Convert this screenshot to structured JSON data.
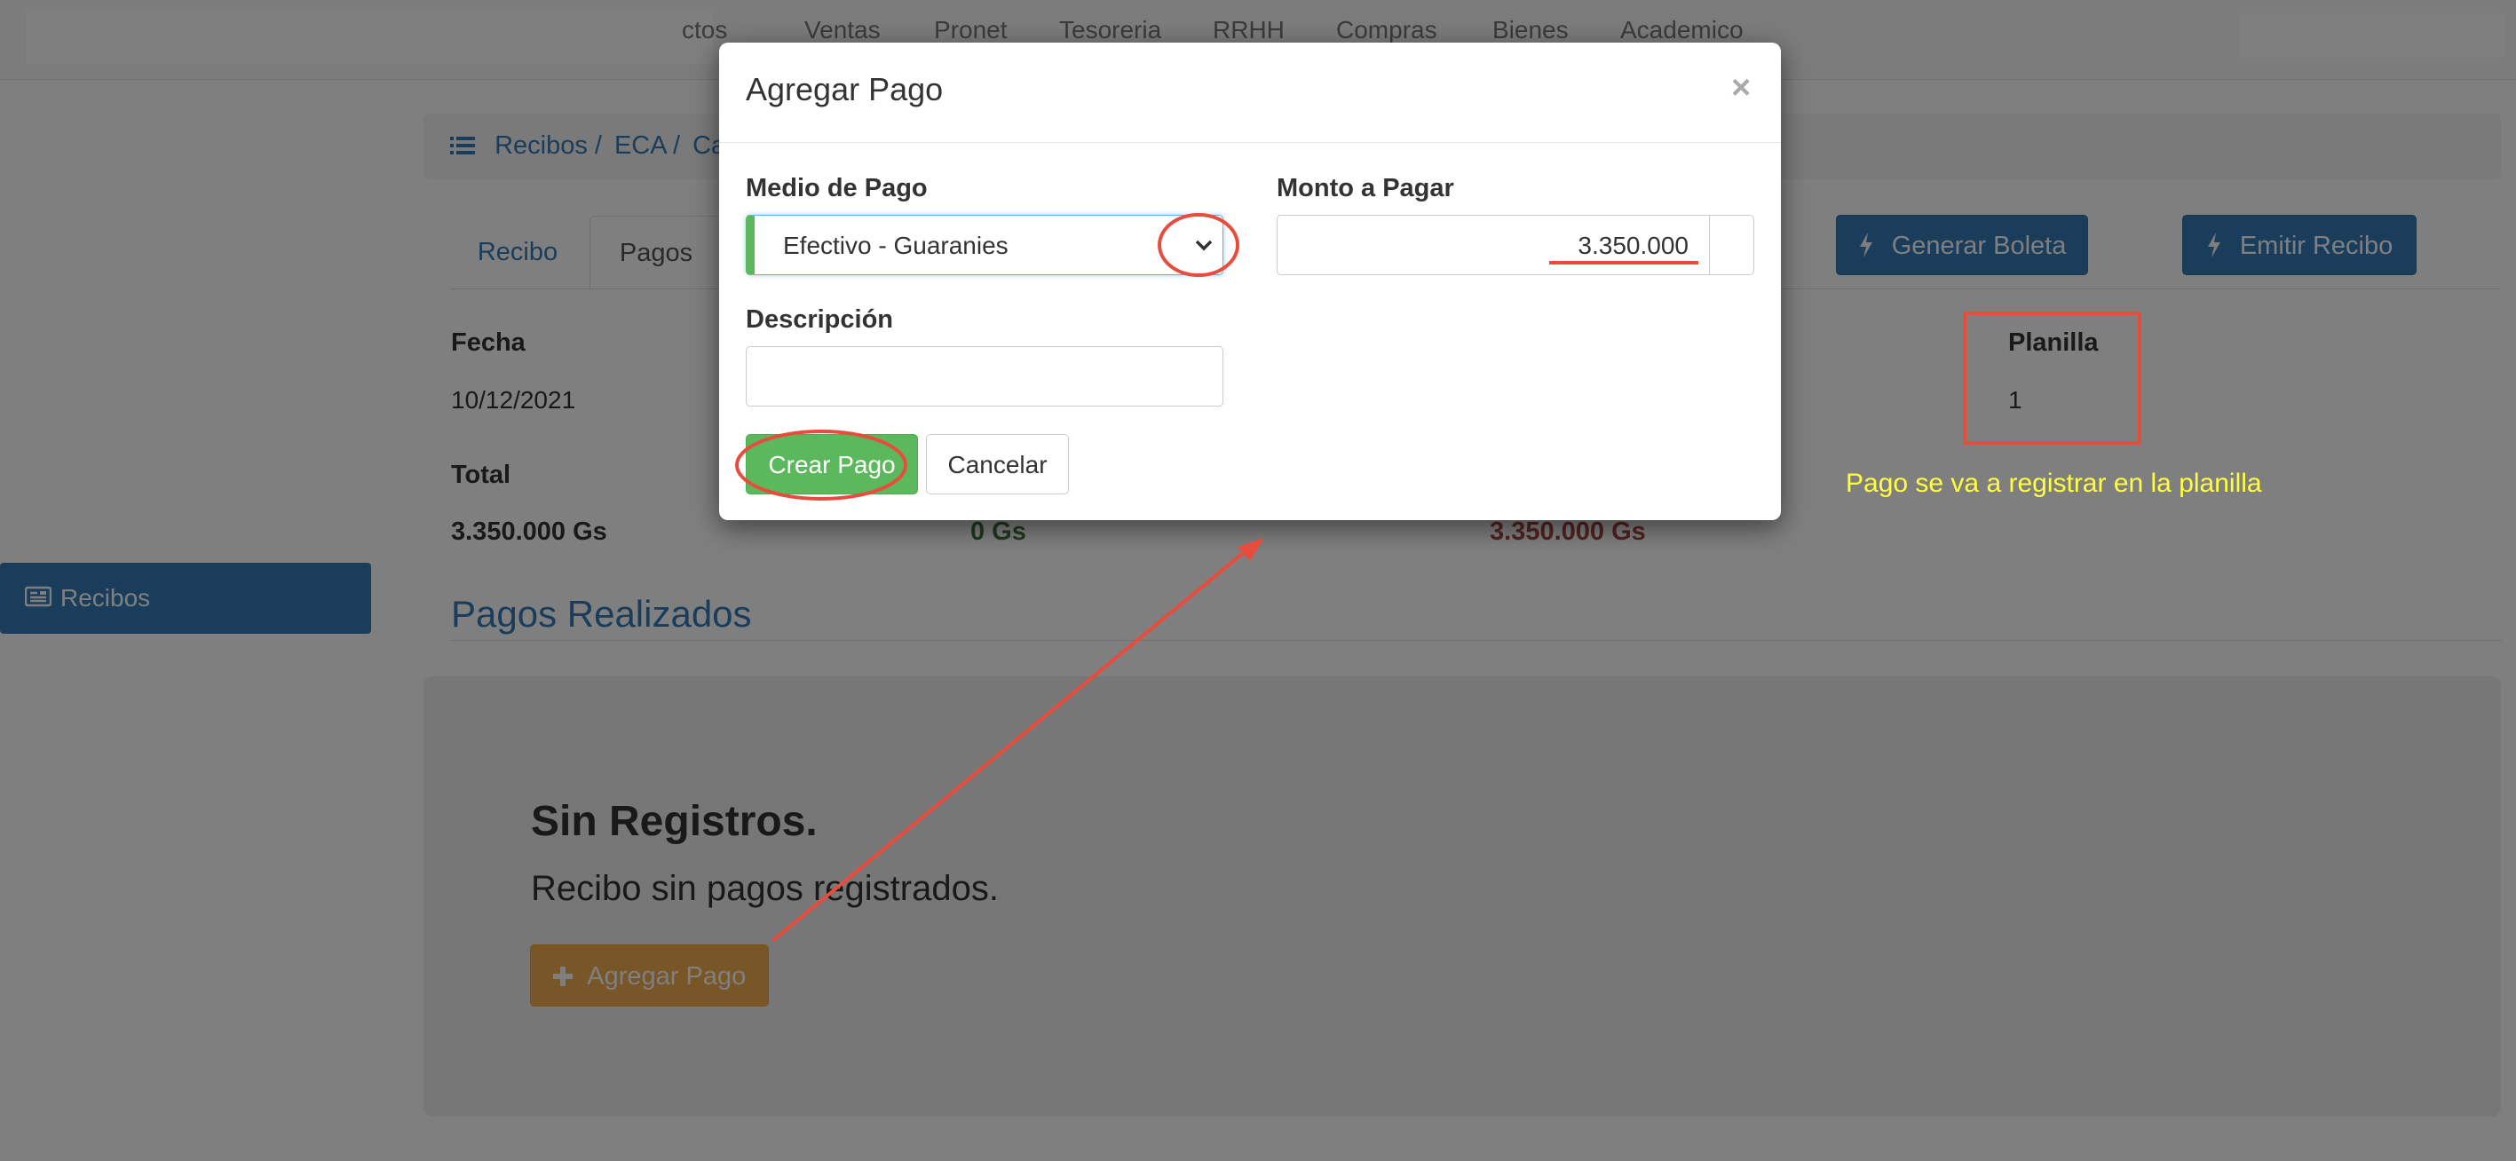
{
  "navbar": {
    "items": [
      "ctos",
      "Ventas",
      "Pronet",
      "Tesoreria",
      "RRHH",
      "Compras",
      "Bienes",
      "Academico"
    ]
  },
  "sidebar": {
    "active_item": {
      "label": "Recibos",
      "icon": "receipt-icon"
    }
  },
  "breadcrumb": {
    "items": [
      "Recibos /",
      "ECA /",
      "Caj"
    ],
    "icon": "list-icon"
  },
  "tabs": [
    {
      "label": "Recibo"
    },
    {
      "label": "Pagos",
      "active": true
    }
  ],
  "actions": {
    "generar_boleta": "Generar Boleta",
    "emitir_recibo": "Emitir Recibo",
    "icon": "bolt-icon"
  },
  "info": {
    "fecha_label": "Fecha",
    "fecha_value": "10/12/2021",
    "planilla_label": "Planilla",
    "planilla_value": "1",
    "total_label": "Total",
    "total_value": "3.350.000 Gs",
    "pagado_value": "0 Gs",
    "saldo_value": "3.350.000 Gs"
  },
  "pagos_realizados": {
    "title": "Pagos Realizados",
    "empty_title": "Sin Registros.",
    "empty_text": "Recibo sin pagos registrados.",
    "add_button": "Agregar Pago",
    "add_icon": "plus-icon"
  },
  "modal": {
    "title": "Agregar Pago",
    "close": "×",
    "medio_label": "Medio de Pago",
    "medio_value": "Efectivo - Guaranies",
    "monto_label": "Monto a Pagar",
    "monto_value": "3.350.000",
    "descripcion_label": "Descripción",
    "descripcion_value": "",
    "crear_button": "Crear Pago",
    "cancelar_button": "Cancelar"
  },
  "annotation": {
    "note": "Pago se va a registrar en la planilla",
    "color": "#e74c3c",
    "note_color": "#ffff40"
  },
  "colors": {
    "primary": "#337ab7",
    "success": "#5cb85c",
    "warning": "#f0ad4e",
    "danger": "#a94442",
    "success_text": "#3c763d"
  }
}
